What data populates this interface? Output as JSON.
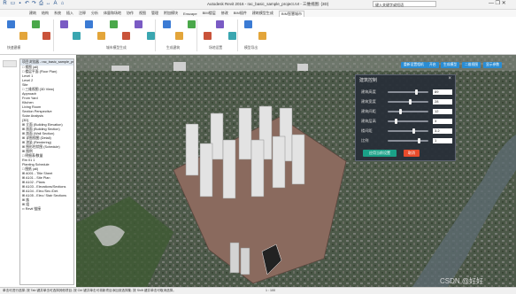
{
  "titlebar": {
    "app_title": "Autodesk Revit 2016 - rac_basic_sample_project.rvt - 三维视图: {3D}",
    "search_placeholder": "键入关键字或短语",
    "window_controls": "— ❐ ✕"
  },
  "ribbon": {
    "tabs": [
      "建筑",
      "结构",
      "系统",
      "插入",
      "注释",
      "分析",
      "体量和场地",
      "协作",
      "视图",
      "管理",
      "附加模块",
      "Enscape",
      "BIM楼层",
      "修改",
      "BIM插件",
      "建筑模型生成",
      "BIM智慧城市"
    ],
    "active_tab": "BIM智慧城市",
    "group_labels": [
      "快速建模",
      "城市模型生成",
      "生成建筑",
      "场地设置",
      "模型导出"
    ]
  },
  "browser": {
    "title": "项目浏览器 - rac_basic_sample_proje...",
    "items": [
      "□ 视图 (all)",
      "  □ 楼层平面 (Floor Plan)",
      "     Level 1",
      "     Level 2",
      "     Site",
      "  □ 三维视图 (3D View)",
      "     Approach",
      "     From Yard",
      "     Kitchen",
      "     Living Room",
      "     Section Perspective",
      "     Solar Analysis",
      "     {3D}",
      "  ⊞ 立面 (Building Elevation)",
      "  ⊞ 剖面 (Building Section)",
      "  ⊞ 剖面 (Wall Section)",
      "  ⊞ 详图视图 (Detail)",
      "  ⊞ 渲染 (Rendering)",
      "  ⊞ 图形柱状图 (Schedule)",
      "⊞ 图例",
      "□ 明细表/数量",
      "     Rm 01 1",
      "     Planting Schedule",
      "□ 图纸 (all)",
      "  ⊞ A001 - Title Sheet",
      "  ⊞ A101 - Site Plan",
      "  ⊞ A102 - Plans",
      "  ⊞ A103 - Elevations/Sections",
      "  ⊞ A104 - Elev./Sec./Det.",
      "  ⊞ A105 - Elev./ Stair Sections",
      "⊞ 族",
      "⊞ 组",
      "  ∞ Revit 链接"
    ]
  },
  "viewport": {
    "buttons": [
      "重新设置相机",
      "开启",
      "生成模型",
      "二维视图",
      "显示参数"
    ]
  },
  "dialog": {
    "title": "建筑控制",
    "close": "×",
    "params": [
      {
        "label": "建筑高度",
        "value": "89",
        "level": 0.72
      },
      {
        "label": "建筑宽度",
        "value": "28",
        "level": 0.55
      },
      {
        "label": "建筑间距",
        "value": "12",
        "level": 0.3
      },
      {
        "label": "建筑层高",
        "value": "3",
        "level": 0.18
      },
      {
        "label": "楼间距",
        "value": "3.2",
        "level": 0.64
      },
      {
        "label": "比例",
        "value": "1",
        "level": 0.8
      }
    ],
    "apply": "应用当前设置",
    "cancel": "取消"
  },
  "statusbar": {
    "text": "单击可进行选择; 按 Tab 键并单击可选择其他项目; 按 Ctrl 键并单击可将新项目添加到选择集; 按 Shift 键并单击可取消选择。",
    "scale": "1 : 100"
  },
  "watermark": "CSDN @好好",
  "colors": {
    "accent_blue": "#2a8dd4",
    "apply_green": "#1aa187",
    "cancel_red": "#e94b2b"
  }
}
